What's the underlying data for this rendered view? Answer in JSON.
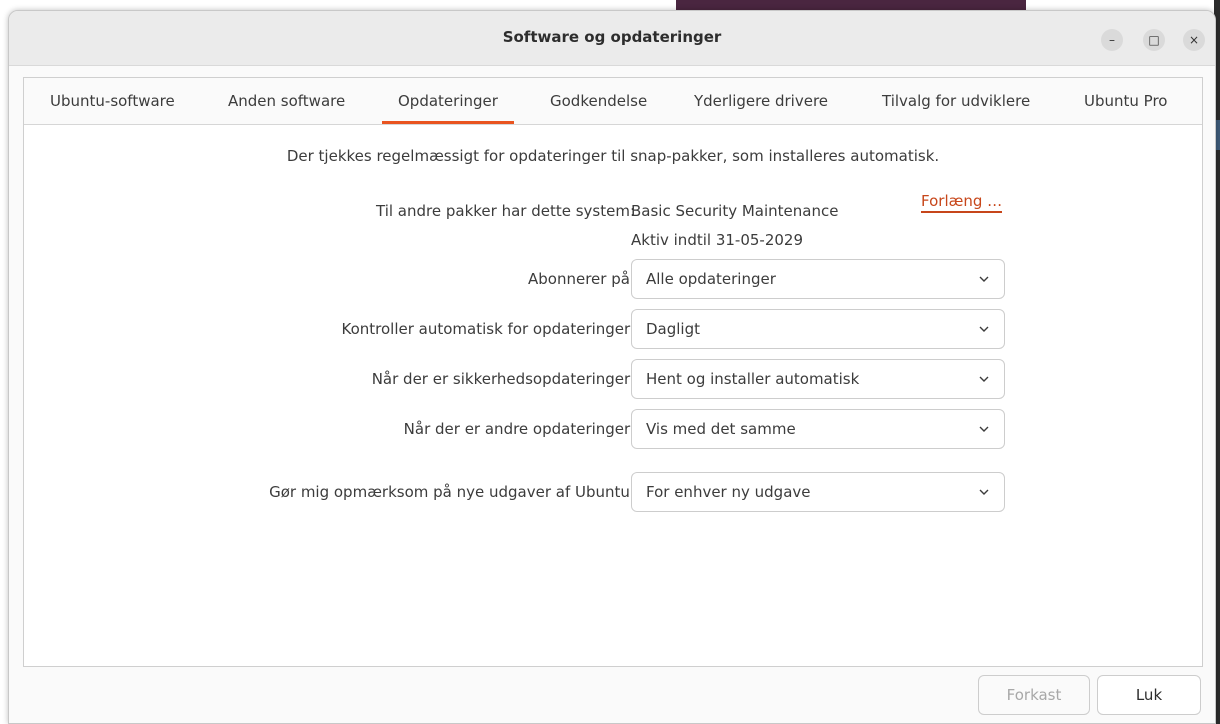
{
  "window": {
    "title": "Software og opdateringer",
    "controls": {
      "minimize": "–",
      "maximize": "□",
      "close": "×"
    }
  },
  "tabs": [
    {
      "label": "Ubuntu-software",
      "active": false
    },
    {
      "label": "Anden software",
      "active": false
    },
    {
      "label": "Opdateringer",
      "active": true
    },
    {
      "label": "Godkendelse",
      "active": false
    },
    {
      "label": "Yderligere drivere",
      "active": false
    },
    {
      "label": "Tilvalg for udviklere",
      "active": false
    },
    {
      "label": "Ubuntu Pro",
      "active": false
    }
  ],
  "updates": {
    "snap_note": "Der tjekkes regelmæssigt for opdateringer til snap-pakker, som installeres automatisk.",
    "system_label": "Til andre pakker har dette system:",
    "system_value": "Basic Security Maintenance",
    "active_until": "Aktiv indtil 31-05-2029",
    "extend_link": "Forlæng …",
    "subscribe_label": "Abonnerer på:",
    "subscribe_value": "Alle opdateringer",
    "check_label": "Kontroller automatisk for opdateringer:",
    "check_value": "Dagligt",
    "security_label": "Når der er sikkerhedsopdateringer:",
    "security_value": "Hent og installer automatisk",
    "other_label": "Når der er andre opdateringer:",
    "other_value": "Vis med det samme",
    "notify_label": "Gør mig opmærksom på nye udgaver af Ubuntu:",
    "notify_value": "For enhver ny udgave"
  },
  "buttons": {
    "discard": "Forkast",
    "close": "Luk"
  },
  "colors": {
    "accent": "#e95420",
    "link": "#c7461a"
  },
  "icons": {
    "dropdown": "chevron-down-icon"
  }
}
